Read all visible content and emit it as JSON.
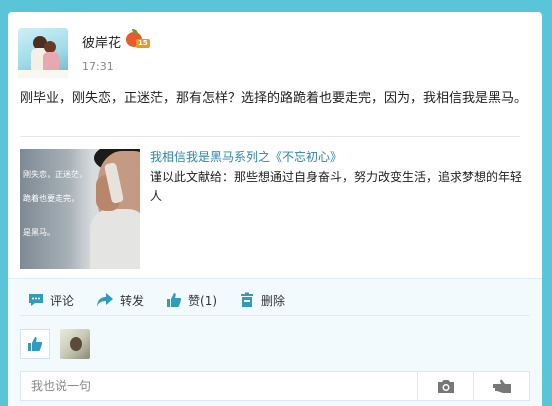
{
  "post": {
    "username": "彼岸花",
    "level_badge": "15",
    "time": "17:31",
    "content": "刚毕业，刚失恋，正迷茫，那有怎样？选择的路跪着也要走完，因为，我相信我是黑马。"
  },
  "article": {
    "title": "我相信我是黑马系列之《不忘初心》",
    "description": "谨以此文献给：那些想通过自身奋斗，努力改变生活，追求梦想的年轻人",
    "thumbnail_lines": [
      "刚失恋，正迷茫，",
      "跪着也要走完，",
      "是黑马。"
    ]
  },
  "actions": {
    "comment": "评论",
    "repost": "转发",
    "like": "赞(1)",
    "delete": "删除"
  },
  "comment_box": {
    "placeholder": "我也说一句"
  },
  "icons": {
    "comment": "comment-icon",
    "repost": "share-arrow-icon",
    "like": "thumbs-up-icon",
    "delete": "trash-icon",
    "camera": "camera-icon",
    "send": "send-hand-icon"
  },
  "colors": {
    "page_background": "#5ac4d9",
    "accent": "#2a86a8",
    "icon": "#2e9bbf"
  }
}
